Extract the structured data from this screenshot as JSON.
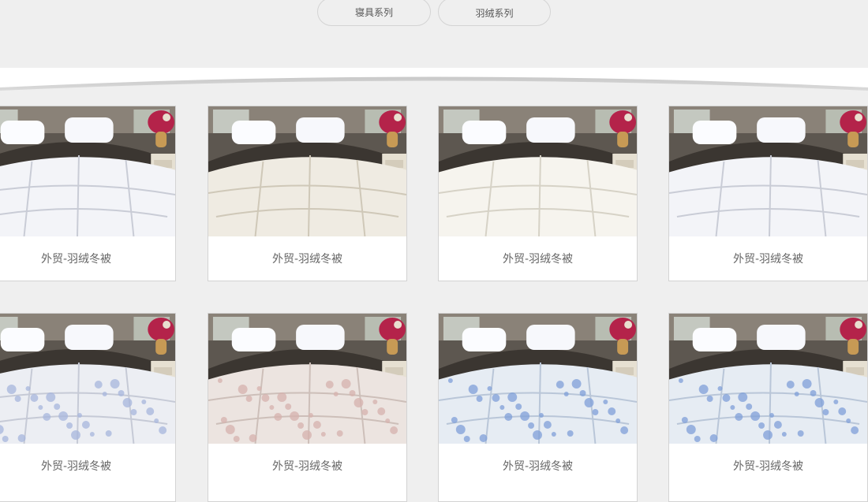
{
  "tabs": [
    {
      "label": "寝具系列"
    },
    {
      "label": "羽绒系列"
    }
  ],
  "products": [
    {
      "name": "外贸-羽绒冬被",
      "quilt": "white"
    },
    {
      "name": "外贸-羽绒冬被",
      "quilt": "cream"
    },
    {
      "name": "外贸-羽绒冬被",
      "quilt": "ivory"
    },
    {
      "name": "外贸-羽绒冬被",
      "quilt": "white"
    },
    {
      "name": "外贸-羽绒冬被",
      "quilt": "pale-floral"
    },
    {
      "name": "外贸-羽绒冬被",
      "quilt": "pink-floral"
    },
    {
      "name": "外贸-羽绒冬被",
      "quilt": "blue-floral"
    },
    {
      "name": "外贸-羽绒冬被",
      "quilt": "blue-floral"
    }
  ],
  "colors": {
    "page_background": "#efefef",
    "card_border": "#d3d3d3",
    "caption_text": "#666666",
    "tab_border": "#d4d4d4"
  }
}
